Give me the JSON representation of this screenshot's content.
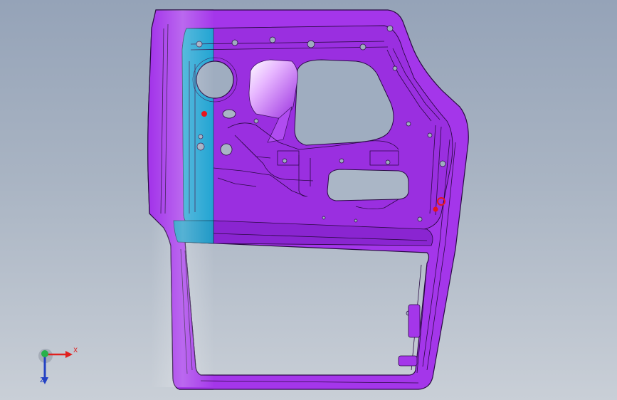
{
  "viewport": {
    "background_top": "#95a3b8",
    "background_bottom": "#c9cfd7"
  },
  "model": {
    "part": "door-inner-panel",
    "colors": {
      "section_a": "#29b7e6",
      "section_b": "#a436ea",
      "section_b_dark": "#7b1fb8",
      "edge": "#2a0a44",
      "marker": "#e8141c"
    }
  },
  "triad": {
    "x_label": "X",
    "y_label": "",
    "z_label": "Z",
    "x_color": "#e0201e",
    "y_color": "#27b14b",
    "z_color": "#2341c4"
  }
}
